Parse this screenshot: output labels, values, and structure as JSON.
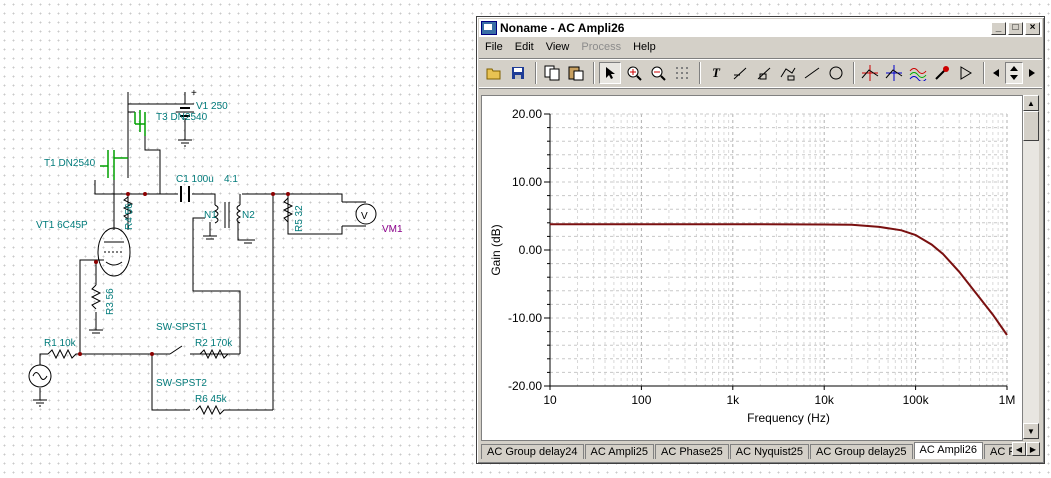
{
  "schematic": {
    "labels": {
      "v1": "V1 250",
      "t3": "T3 DN2540",
      "t1": "T1 DN2540",
      "c1": "C1 100u",
      "ratio": "4:1",
      "n1": "N1",
      "n2": "N2",
      "vt1": "VT1 6C45P",
      "r4": "R4 56",
      "r5": "R5 32",
      "vm1": "VM1",
      "r3": "R3 56",
      "sw1": "SW-SPST1",
      "r1": "R1 10k",
      "r2": "R2 170k",
      "sw2": "SW-SPST2",
      "r6": "R6 45k",
      "meter_symbol": "V"
    }
  },
  "window": {
    "title": "Noname - AC Ampli26",
    "controls": {
      "minimize": "_",
      "maximize": "□",
      "close": "×"
    },
    "menu": [
      "File",
      "Edit",
      "View",
      "Process",
      "Help"
    ],
    "menu_disabled": "Process",
    "toolbar_icons": [
      "open-icon",
      "save-icon",
      "copy-icon",
      "paste-icon",
      "pointer-icon",
      "zoom-in-icon",
      "zoom-out-icon",
      "grid-icon",
      "text-icon",
      "line-tool-icon",
      "label-tool-icon",
      "curve-tool-icon",
      "line-icon",
      "circle-icon",
      "cursor-a-icon",
      "cursor-b-icon",
      "waveform-icon",
      "marker-icon",
      "triangle-icon",
      "scroll-left-icon",
      "scroll-updown-icon",
      "scroll-right-icon"
    ],
    "toolbar_glyphs": {
      "text": "T"
    },
    "tabs": [
      "AC Group delay24",
      "AC Ampli25",
      "AC Phase25",
      "AC Nyquist25",
      "AC Group delay25",
      "AC Ampli26",
      "AC Phas"
    ],
    "active_tab": "AC Ampli26"
  },
  "chart_data": {
    "type": "line",
    "xlabel": "Frequency (Hz)",
    "ylabel": "Gain (dB)",
    "x_scale": "log",
    "xlim": [
      10,
      1000000
    ],
    "ylim": [
      -20,
      20
    ],
    "x_ticks": [
      10,
      100,
      1000,
      10000,
      100000,
      1000000
    ],
    "x_tick_labels": [
      "10",
      "100",
      "1k",
      "10k",
      "100k",
      "1M"
    ],
    "y_ticks": [
      20,
      10,
      0,
      -10,
      -20
    ],
    "y_tick_labels": [
      "20.00",
      "10.00",
      "0.00",
      "-10.00",
      "-20.00"
    ],
    "grid": true,
    "line_color": "#7a1010",
    "series": [
      {
        "x": [
          10,
          100,
          1000,
          10000,
          20000,
          40000,
          70000,
          100000,
          150000,
          200000,
          300000,
          500000,
          700000,
          1000000
        ],
        "y": [
          3.8,
          3.8,
          3.8,
          3.75,
          3.7,
          3.4,
          2.9,
          2.2,
          0.8,
          -0.6,
          -3.2,
          -7.0,
          -9.5,
          -12.5
        ]
      }
    ]
  }
}
